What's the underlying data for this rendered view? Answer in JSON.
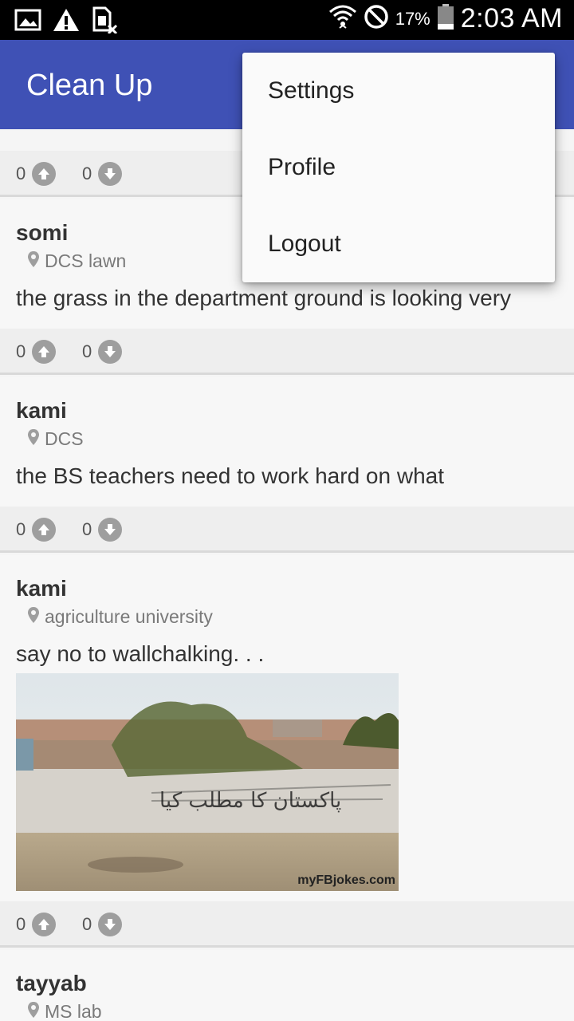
{
  "status_bar": {
    "time": "2:03 AM",
    "battery_percent": "17%",
    "icons": [
      "gallery-icon",
      "warning-icon",
      "no-sim-icon",
      "wifi-icon",
      "blocked-icon",
      "battery-icon"
    ]
  },
  "app_bar": {
    "title": "Clean Up",
    "color": "#3f51b5"
  },
  "overflow_menu": {
    "items": [
      {
        "label": "Settings"
      },
      {
        "label": "Profile"
      },
      {
        "label": "Logout"
      }
    ]
  },
  "feed": {
    "top_votes": {
      "up": "0",
      "down": "0"
    },
    "posts": [
      {
        "user": "somi",
        "location": "DCS lawn",
        "text": "the grass in the department ground is looking very",
        "up": "0",
        "down": "0"
      },
      {
        "user": "kami",
        "location": "DCS",
        "text": "the BS teachers need to work hard on what",
        "up": "0",
        "down": "0"
      },
      {
        "user": "kami",
        "location": "agriculture university",
        "text": "say no to wallchalking. . .",
        "image_watermark": "myFBjokes.com",
        "up": "0",
        "down": "0"
      },
      {
        "user": "tayyab",
        "location": "MS lab"
      }
    ]
  }
}
